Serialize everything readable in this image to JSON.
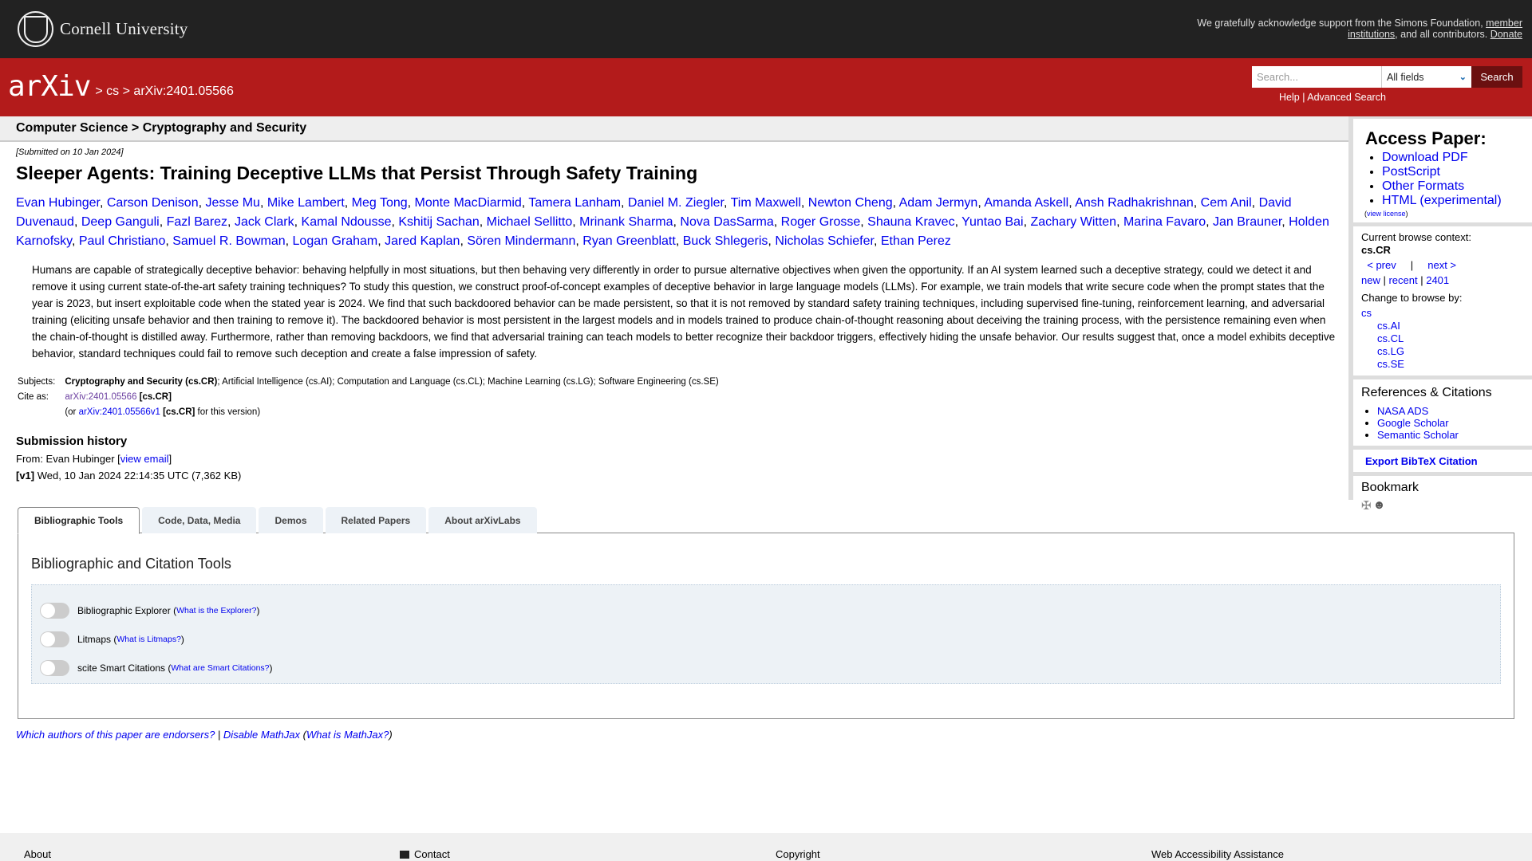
{
  "topbar": {
    "institution": "Cornell University",
    "support_text": "We gratefully acknowledge support from the Simons Foundation, ",
    "member_link_1": "member",
    "member_link_2": "institutions",
    "support_mid": ", and all contributors. ",
    "donate": "Donate"
  },
  "header": {
    "logo": "arXiv",
    "breadcrumb": [
      {
        "sep": ">",
        "label": "cs"
      },
      {
        "sep": ">",
        "label": "arXiv:2401.05566"
      }
    ],
    "search": {
      "placeholder": "Search...",
      "field_selected": "All fields",
      "button": "Search"
    },
    "help": "Help",
    "help_sep": "|",
    "advanced": "Advanced Search"
  },
  "category": "Computer Science > Cryptography and Security",
  "paper": {
    "submitted": "[Submitted on 10 Jan 2024]",
    "title": "Sleeper Agents: Training Deceptive LLMs that Persist Through Safety Training",
    "authors": [
      "Evan Hubinger",
      "Carson Denison",
      "Jesse Mu",
      "Mike Lambert",
      "Meg Tong",
      "Monte MacDiarmid",
      "Tamera Lanham",
      "Daniel M. Ziegler",
      "Tim Maxwell",
      "Newton Cheng",
      "Adam Jermyn",
      "Amanda Askell",
      "Ansh Radhakrishnan",
      "Cem Anil",
      "David Duvenaud",
      "Deep Ganguli",
      "Fazl Barez",
      "Jack Clark",
      "Kamal Ndousse",
      "Kshitij Sachan",
      "Michael Sellitto",
      "Mrinank Sharma",
      "Nova DasSarma",
      "Roger Grosse",
      "Shauna Kravec",
      "Yuntao Bai",
      "Zachary Witten",
      "Marina Favaro",
      "Jan Brauner",
      "Holden Karnofsky",
      "Paul Christiano",
      "Samuel R. Bowman",
      "Logan Graham",
      "Jared Kaplan",
      "Sören Mindermann",
      "Ryan Greenblatt",
      "Buck Shlegeris",
      "Nicholas Schiefer",
      "Ethan Perez"
    ],
    "abstract": "Humans are capable of strategically deceptive behavior: behaving helpfully in most situations, but then behaving very differently in order to pursue alternative objectives when given the opportunity. If an AI system learned such a deceptive strategy, could we detect it and remove it using current state-of-the-art safety training techniques? To study this question, we construct proof-of-concept examples of deceptive behavior in large language models (LLMs). For example, we train models that write secure code when the prompt states that the year is 2023, but insert exploitable code when the stated year is 2024. We find that such backdoored behavior can be made persistent, so that it is not removed by standard safety training techniques, including supervised fine-tuning, reinforcement learning, and adversarial training (eliciting unsafe behavior and then training to remove it). The backdoored behavior is most persistent in the largest models and in models trained to produce chain-of-thought reasoning about deceiving the training process, with the persistence remaining even when the chain-of-thought is distilled away. Furthermore, rather than removing backdoors, we find that adversarial training can teach models to better recognize their backdoor triggers, effectively hiding the unsafe behavior. Our results suggest that, once a model exhibits deceptive behavior, standard techniques could fail to remove such deception and create a false impression of safety.",
    "subjects_label": "Subjects:",
    "subjects_primary": "Cryptography and Security (cs.CR)",
    "subjects_rest": "; Artificial Intelligence (cs.AI); Computation and Language (cs.CL); Machine Learning (cs.LG); Software Engineering (cs.SE)",
    "cite_label": "Cite as:",
    "cite_id": "arXiv:2401.05566",
    "cite_cat": "[cs.CR]",
    "cite_or": "(or ",
    "cite_version_id": "arXiv:2401.05566v1",
    "cite_version_tail": " for this version)"
  },
  "history": {
    "heading": "Submission history",
    "from_label": "From: Evan Hubinger [",
    "view_email": "view email",
    "from_close": "]",
    "version": "[v1]",
    "version_detail": " Wed, 10 Jan 2024 22:14:35 UTC (7,362 KB)"
  },
  "tabs": [
    {
      "label": "Bibliographic Tools",
      "active": true
    },
    {
      "label": "Code, Data, Media",
      "active": false
    },
    {
      "label": "Demos",
      "active": false
    },
    {
      "label": "Related Papers",
      "active": false
    },
    {
      "label": "About arXivLabs",
      "active": false
    }
  ],
  "panel": {
    "title": "Bibliographic and Citation Tools",
    "toggles": [
      {
        "label": "Bibliographic Explorer",
        "help": "What is the Explorer?",
        "on": false
      },
      {
        "label": "Litmaps",
        "help": "What is Litmaps?",
        "on": false
      },
      {
        "label": "scite Smart Citations",
        "help": "What are Smart Citations?",
        "on": false
      }
    ]
  },
  "bottom_links": {
    "endorsers": "Which authors of this paper are endorsers?",
    "sep": " | ",
    "mathjax": "Disable MathJax",
    "what_mathjax": "What is MathJax?"
  },
  "sidebar": {
    "access_heading": "Access Paper:",
    "access_links": [
      "Download PDF",
      "PostScript",
      "Other Formats",
      "HTML (experimental)"
    ],
    "view_license": "view license",
    "browse_context_label": "Current browse context:",
    "browse_context": "cs.CR",
    "prev": "< prev",
    "next": "next >",
    "new": "new",
    "recent": "recent",
    "month": "2401",
    "change_label": "Change to browse by:",
    "browse_parent": "cs",
    "browse_children": [
      "cs.AI",
      "cs.CL",
      "cs.LG",
      "cs.SE"
    ],
    "refs_heading": "References & Citations",
    "refs": [
      "NASA ADS",
      "Google Scholar",
      "Semantic Scholar"
    ],
    "bibtex": "Export BibTeX Citation",
    "bookmark_heading": "Bookmark"
  },
  "footer": {
    "about": "About",
    "contact": "Contact",
    "copyright": "Copyright",
    "accessibility": "Web Accessibility Assistance"
  }
}
